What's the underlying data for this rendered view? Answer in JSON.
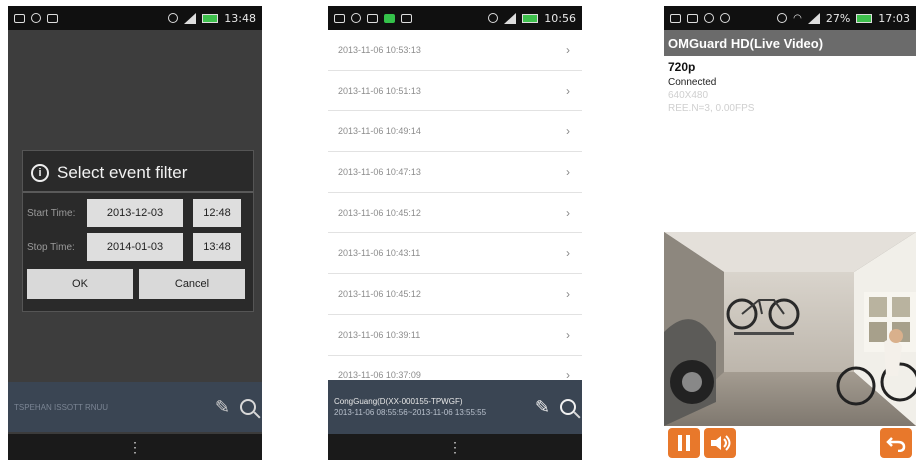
{
  "phone1": {
    "status_time": "13:48",
    "dialog": {
      "title": "Select event filter",
      "start_label": "Start Time:",
      "start_date": "2013-12-03",
      "start_time": "12:48",
      "stop_label": "Stop Time:",
      "stop_date": "2014-01-03",
      "stop_time": "13:48",
      "ok_label": "OK",
      "cancel_label": "Cancel"
    },
    "toolbar_text": "TSPEHAN ISSOTT RNUU",
    "nav_glyph": "⋮"
  },
  "phone2": {
    "status_time": "10:56",
    "events": [
      "2013-11-06 10:53:13",
      "2013-11-06 10:51:13",
      "2013-11-06 10:49:14",
      "2013-11-06 10:47:13",
      "2013-11-06 10:45:12",
      "2013-11-06 10:43:11",
      "2013-11-06 10:45:12",
      "2013-11-06 10:39:11",
      "2013-11-06 10:37:09"
    ],
    "chevron": "›",
    "device_name": "CongGuang(D(XX-000155-TPWGF)",
    "device_range": "2013-11-06 08:55:56~2013-11-06 13:55:55",
    "nav_glyph": "⋮"
  },
  "phone3": {
    "status_battery": "27%",
    "status_time": "17:03",
    "app_title": "OMGuard HD(Live Video)",
    "resolution": "720p",
    "connection": "Connected",
    "frame_size": "640X480",
    "stats": "REE.N=3, 0.00FPS"
  },
  "colors": {
    "accent_orange": "#e8782b",
    "toolbar_blue": "#3a4553",
    "status_green": "#3ec04d"
  },
  "icons": [
    "info-icon",
    "pencil-icon",
    "search-icon",
    "pause-icon",
    "speaker-icon",
    "back-icon",
    "chevron-right-icon",
    "menu-dots-icon"
  ]
}
